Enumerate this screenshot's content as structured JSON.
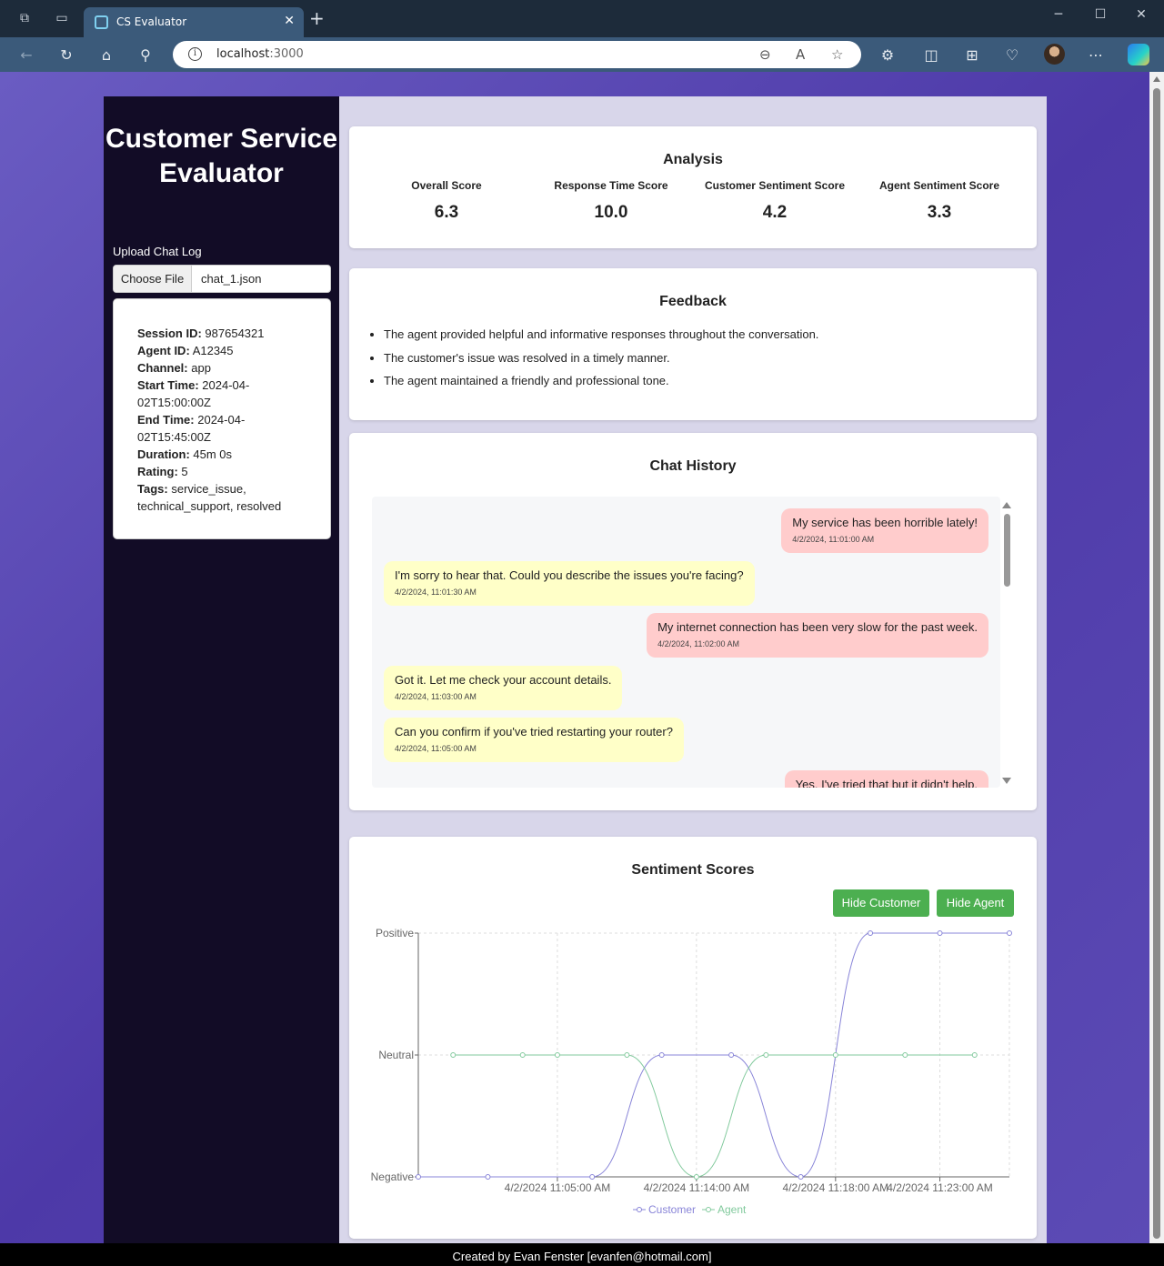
{
  "browser": {
    "tab_title": "CS Evaluator",
    "tab_close": "✕",
    "new_tab": "+",
    "url_host": "localhost",
    "url_port": ":3000"
  },
  "sidebar": {
    "title": "Customer Service Evaluator",
    "upload_label": "Upload Chat Log",
    "choose_file_label": "Choose File",
    "file_name": "chat_1.json",
    "session": {
      "session_id_label": "Session ID:",
      "session_id": "987654321",
      "agent_id_label": "Agent ID:",
      "agent_id": "A12345",
      "channel_label": "Channel:",
      "channel": "app",
      "start_time_label": "Start Time:",
      "start_time": "2024-04-02T15:00:00Z",
      "end_time_label": "End Time:",
      "end_time": "2024-04-02T15:45:00Z",
      "duration_label": "Duration:",
      "duration": "45m 0s",
      "rating_label": "Rating:",
      "rating": "5",
      "tags_label": "Tags:",
      "tags": "service_issue, technical_support, resolved"
    }
  },
  "analysis": {
    "title": "Analysis",
    "scores": [
      {
        "label": "Overall Score",
        "value": "6.3"
      },
      {
        "label": "Response Time Score",
        "value": "10.0"
      },
      {
        "label": "Customer Sentiment Score",
        "value": "4.2"
      },
      {
        "label": "Agent Sentiment Score",
        "value": "3.3"
      }
    ]
  },
  "feedback": {
    "title": "Feedback",
    "items": [
      "The agent provided helpful and informative responses throughout the conversation.",
      "The customer's issue was resolved in a timely manner.",
      "The agent maintained a friendly and professional tone."
    ]
  },
  "chat_history": {
    "title": "Chat History",
    "messages": [
      {
        "role": "customer",
        "text": "My service has been horrible lately!",
        "time": "4/2/2024, 11:01:00 AM"
      },
      {
        "role": "agent",
        "text": "I'm sorry to hear that. Could you describe the issues you're facing?",
        "time": "4/2/2024, 11:01:30 AM"
      },
      {
        "role": "customer",
        "text": "My internet connection has been very slow for the past week.",
        "time": "4/2/2024, 11:02:00 AM"
      },
      {
        "role": "agent",
        "text": "Got it. Let me check your account details.",
        "time": "4/2/2024, 11:03:00 AM"
      },
      {
        "role": "agent",
        "text": "Can you confirm if you've tried restarting your router?",
        "time": "4/2/2024, 11:05:00 AM"
      },
      {
        "role": "customer",
        "text": "Yes, I've tried that but it didn't help.",
        "time": ""
      }
    ]
  },
  "sentiment": {
    "title": "Sentiment Scores",
    "hide_customer_label": "Hide Customer",
    "hide_agent_label": "Hide Agent"
  },
  "chart_data": {
    "type": "line",
    "title": "Sentiment Scores",
    "y_categories": [
      "Negative",
      "Neutral",
      "Positive"
    ],
    "x_tick_labels": [
      "4/2/2024 11:05:00 AM",
      "4/2/2024 11:14:00 AM",
      "4/2/2024 11:18:00 AM",
      "4/2/2024 11:23:00 AM"
    ],
    "x_tick_index": [
      2,
      4,
      6,
      7.5
    ],
    "grid": true,
    "legend_position": "bottom",
    "series": [
      {
        "name": "Customer",
        "color": "#8884d8",
        "x": [
          0,
          1,
          2.5,
          3.5,
          4.5,
          5.5,
          6.5,
          7.5,
          8.5
        ],
        "values": [
          -1,
          -1,
          -1,
          0,
          0,
          -1,
          1,
          1,
          1
        ]
      },
      {
        "name": "Agent",
        "color": "#82ca9d",
        "x": [
          0.5,
          1.5,
          2,
          3,
          4,
          5,
          6,
          7,
          8
        ],
        "values": [
          0,
          0,
          0,
          0,
          -1,
          0,
          0,
          0,
          0
        ]
      }
    ],
    "x_range": [
      0,
      8.5
    ],
    "y_range": [
      -1,
      1
    ]
  },
  "footer": {
    "text": "Created by Evan Fenster [evanfen@hotmail.com]"
  }
}
